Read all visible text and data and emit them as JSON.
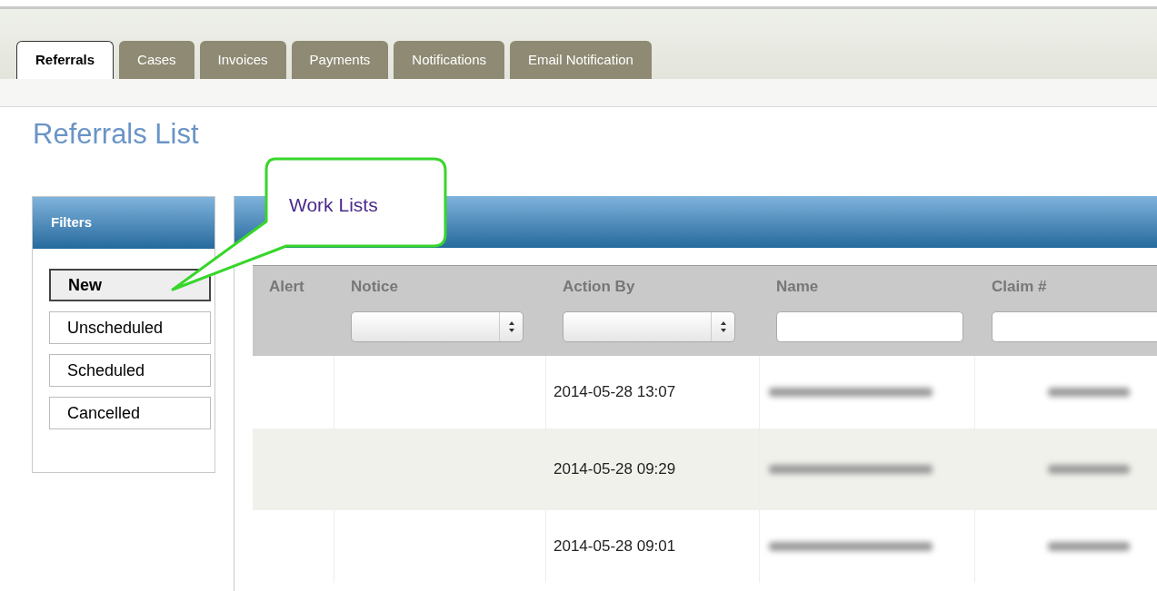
{
  "tabs": [
    {
      "label": "Referrals",
      "selected": true
    },
    {
      "label": "Cases",
      "selected": false
    },
    {
      "label": "Invoices",
      "selected": false
    },
    {
      "label": "Payments",
      "selected": false
    },
    {
      "label": "Notifications",
      "selected": false
    },
    {
      "label": "Email Notification",
      "selected": false
    }
  ],
  "title": "Referrals List",
  "filters": {
    "title": "Filters",
    "items": [
      {
        "label": "New",
        "selected": true
      },
      {
        "label": "Unscheduled",
        "selected": false
      },
      {
        "label": "Scheduled",
        "selected": false
      },
      {
        "label": "Cancelled",
        "selected": false
      }
    ]
  },
  "callout": {
    "text": "Work Lists"
  },
  "table": {
    "columns": [
      {
        "label": "Alert",
        "kind": "none"
      },
      {
        "label": "Notice",
        "kind": "select"
      },
      {
        "label": "Action By",
        "kind": "select"
      },
      {
        "label": "Name",
        "kind": "text"
      },
      {
        "label": "Claim #",
        "kind": "text"
      }
    ],
    "rows": [
      {
        "action_by": "2014-05-28 13:07"
      },
      {
        "action_by": "2014-05-28 09:29"
      },
      {
        "action_by": "2014-05-28 09:01"
      }
    ]
  }
}
